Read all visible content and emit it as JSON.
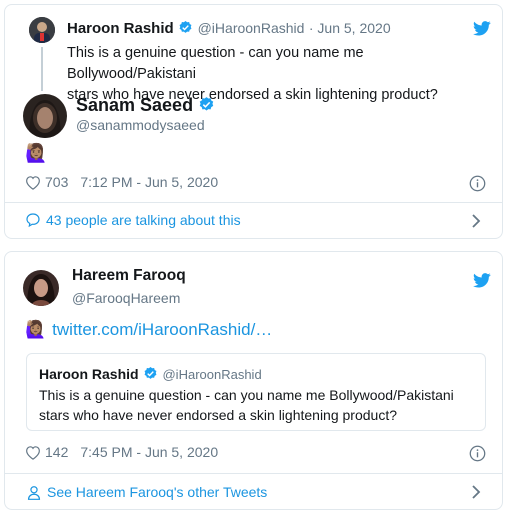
{
  "tweet1": {
    "parent": {
      "name": "Haroon Rashid",
      "handle": "@iHaroonRashid",
      "date": "· Jun 5, 2020",
      "text_line1": "This is a genuine question - can you name me Bollywood/Pakistani",
      "text_line2": "stars who have never endorsed a skin lightening product?"
    },
    "reply": {
      "name": "Sanam Saeed",
      "handle": "@sanammodysaeed",
      "emoji": "🙋🏽‍♀️",
      "likes": "703",
      "time": "7:12 PM - Jun 5, 2020"
    },
    "footer_text": "43 people are talking about this"
  },
  "tweet2": {
    "name": "Hareem Farooq",
    "handle": "@FarooqHareem",
    "emoji": "🙋🏽‍♀️",
    "link_text": "twitter.com/iHaroonRashid/…",
    "quote": {
      "name": "Haroon Rashid",
      "handle": "@iHaroonRashid",
      "text_line1": "This is a genuine question - can you name me Bollywood/Pakistani",
      "text_line2": "stars who have never endorsed a skin lightening product?"
    },
    "likes": "142",
    "time": "7:45 PM - Jun 5, 2020",
    "footer_text": "See Hareem Farooq's other Tweets"
  },
  "colors": {
    "twitter_blue": "#1da1f2",
    "link_blue": "#1b95e0",
    "muted_gray": "#657786",
    "border": "#e1e8ed"
  },
  "icons": [
    "twitter-bird-icon",
    "verified-badge-icon",
    "heart-icon",
    "info-icon",
    "chat-bubble-icon",
    "chevron-right-icon",
    "person-icon"
  ]
}
